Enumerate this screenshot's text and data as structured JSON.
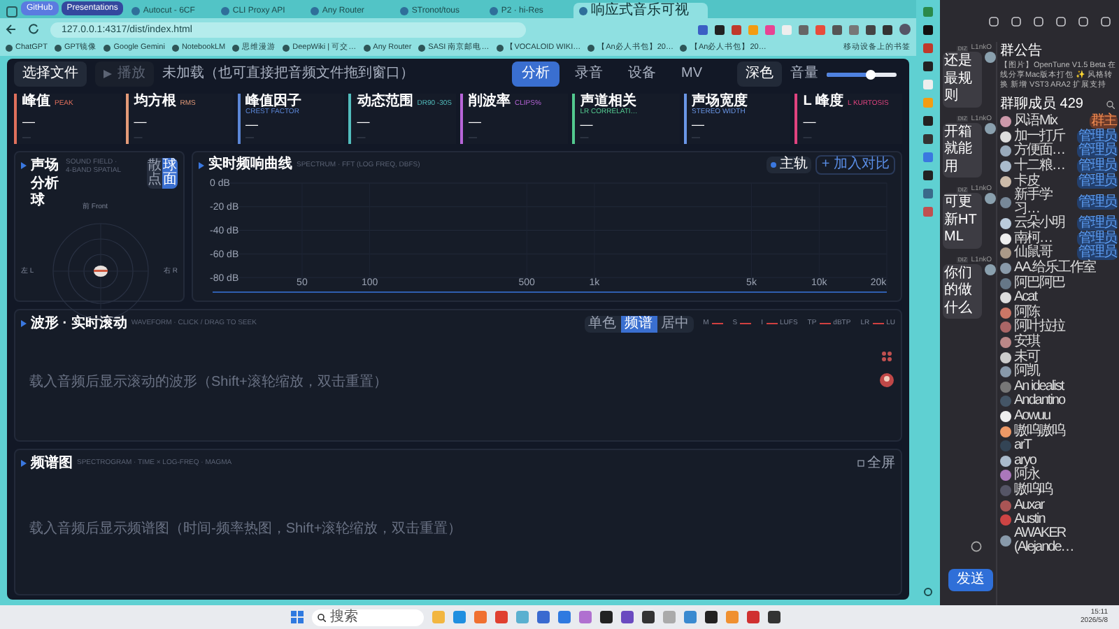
{
  "browser": {
    "tab_groups": [
      {
        "label": "GitHub",
        "color": "#5b7be0"
      },
      {
        "label": "Presentations",
        "color": "#34489e"
      }
    ],
    "tabs": [
      {
        "title": "Autocut - 6CF",
        "selected": false
      },
      {
        "title": "CLI Proxy API",
        "selected": false
      },
      {
        "title": "Any Router",
        "selected": false
      },
      {
        "title": "STronot/tous",
        "selected": false
      },
      {
        "title": "P2 · hi-Res",
        "selected": false
      },
      {
        "title": "响应式音乐可视",
        "selected": true
      }
    ],
    "address": "127.0.0.1:4317/dist/index.html",
    "bookmarks": [
      "ChatGPT",
      "GPT镜像",
      "Google Gemini",
      "NotebookLM",
      "思维漫游",
      "DeepWiki | 可交…",
      "Any Router",
      "SASI 南京邮电…",
      "【VOCALOID WIKI…",
      "【An必人书包】20…",
      "【An必人书包】20…"
    ],
    "bookmarks_folder": "移动设备上的书签"
  },
  "app": {
    "toolbar": {
      "open_button": "选择文件",
      "play_button": {
        "label": "播放",
        "disabled": true
      },
      "status": "未加载（也可直接把音频文件拖到窗口）",
      "tabs": [
        {
          "label": "分析",
          "selected": true
        },
        {
          "label": "录音",
          "selected": false
        },
        {
          "label": "设备",
          "selected": false
        },
        {
          "label": "MV",
          "selected": false
        }
      ],
      "theme_button": "深色",
      "volume_label": "音量",
      "volume": {
        "level": 0.62
      }
    },
    "metrics": [
      {
        "label": "峰值",
        "tag": "PEAK",
        "color": "#e0705c",
        "value": "—",
        "sub": "—"
      },
      {
        "label": "均方根",
        "tag": "RMS",
        "color": "#e39a78",
        "value": "—",
        "sub": "—"
      },
      {
        "label": "峰值因子",
        "tag": "CREST FACTOR",
        "color": "#5b86d6",
        "value": "—",
        "sub": "—"
      },
      {
        "label": "动态范围",
        "tag": "DR90 -30S",
        "color": "#52bdbd",
        "value": "—",
        "sub": "—"
      },
      {
        "label": "削波率",
        "tag": "CLIPS%",
        "color": "#b765d8",
        "value": "—",
        "sub": "—"
      },
      {
        "label": "声道相关",
        "tag": "LR CORRELATI…",
        "color": "#53c98f",
        "value": "—",
        "sub": "—"
      },
      {
        "label": "声场宽度",
        "tag": "STEREO WIDTH",
        "color": "#6a96e6",
        "value": "—",
        "sub": "—"
      },
      {
        "label": "L 峰度",
        "tag": "L KURTOSIS",
        "color": "#e0437f",
        "value": "—",
        "sub": "—"
      }
    ],
    "sound_field": {
      "title": "声场分析球",
      "subtitle": "SOUND FIELD · 4-BAND SPATIAL",
      "modes": [
        {
          "label": "散点",
          "selected": false
        },
        {
          "label": "球面",
          "selected": true
        }
      ],
      "front": "前 Front",
      "left": "左 L",
      "right": "右 R"
    },
    "spectrum": {
      "title": "实时频响曲线",
      "subtitle": "SPECTRUM · FFT (LOG FREQ, DBFS)",
      "main_button": "主轨",
      "compare_button": "+ 加入对比",
      "y_axis_labels": [
        "0 dB",
        "-20 dB",
        "-40 dB",
        "-60 dB",
        "-80 dB"
      ],
      "x_axis_labels": [
        "50",
        "100",
        "500",
        "1k",
        "5k",
        "10k",
        "20k"
      ]
    },
    "waveform": {
      "title": "波形 · 实时滚动",
      "subtitle": "WAVEFORM · CLICK / DRAG TO SEEK",
      "modes": [
        {
          "label": "单色",
          "selected": false
        },
        {
          "label": "频谱",
          "selected": true
        },
        {
          "label": "居中",
          "selected": false
        }
      ],
      "meters": [
        {
          "label": "M"
        },
        {
          "label": "S"
        },
        {
          "label": "I",
          "unit": "LUFS"
        },
        {
          "label": "TP",
          "unit": "dBTP"
        },
        {
          "label": "LR",
          "unit": "LU"
        }
      ],
      "placeholder": "载入音频后显示滚动的波形（Shift+滚轮缩放，双击重置）"
    },
    "spectrogram": {
      "title": "频谱图",
      "subtitle": "SPECTROGRAM · TIME × LOG-FREQ · MAGMA",
      "button": "全屏",
      "placeholder": "载入音频后显示频谱图（时间-频率热图，Shift+滚轮缩放，双击重置）"
    }
  },
  "chat": {
    "messages": [
      {
        "sender": "L1nkO",
        "badge": "DIZ",
        "text": "还是最规则"
      },
      {
        "sender": "L1nkO",
        "badge": "DIZ",
        "text": "开箱就能用"
      },
      {
        "sender": "L1nkO",
        "badge": "DIZ",
        "text": "可更新HTML"
      },
      {
        "sender": "L1nkO",
        "badge": "DIZ",
        "text": "你们的做什么"
      }
    ],
    "announcement_title": "群公告",
    "announcement": "【图片】OpenTune V1.5 Beta 在线分享Mac版本打包 ✨ 风格转换 新增 VST3 ARA2 扩展支持",
    "members_title": "群聊成员 429",
    "members": [
      {
        "name": "风语Mix",
        "role": "群主"
      },
      {
        "name": "加一打斤",
        "role": "管理员"
      },
      {
        "name": "方便面…",
        "role": "管理员"
      },
      {
        "name": "十二粮…",
        "role": "管理员"
      },
      {
        "name": "卡皮",
        "role": "管理员"
      },
      {
        "name": "新手学习…",
        "role": "管理员"
      },
      {
        "name": "云朵小明",
        "role": "管理员"
      },
      {
        "name": "南柯…",
        "role": "管理员"
      },
      {
        "name": "仙鼠哥",
        "role": "管理员"
      },
      {
        "name": "AA.给乐工作室"
      },
      {
        "name": "阿巴阿巴"
      },
      {
        "name": "Acat"
      },
      {
        "name": "阿陈"
      },
      {
        "name": "阿叶拉拉"
      },
      {
        "name": "安琪"
      },
      {
        "name": "未可"
      },
      {
        "name": "阿凯"
      },
      {
        "name": "An idealist"
      },
      {
        "name": "Andantino"
      },
      {
        "name": "Aowuu"
      },
      {
        "name": "嗷呜嗷呜"
      },
      {
        "name": "arT"
      },
      {
        "name": "aryo"
      },
      {
        "name": "阿永"
      },
      {
        "name": "嗷呜呜"
      },
      {
        "name": "Auxar"
      },
      {
        "name": "Austin"
      },
      {
        "name": "AWAKER (Alejande…"
      }
    ],
    "send_button": "发送"
  },
  "taskbar": {
    "search": "搜索",
    "time": "15:11",
    "date": "2026/5/8"
  }
}
